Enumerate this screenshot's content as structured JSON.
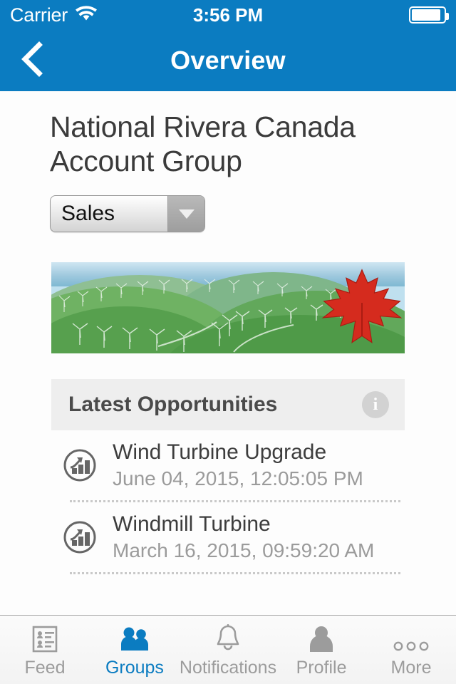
{
  "status_bar": {
    "carrier": "Carrier",
    "wifi_icon": "wifi-icon",
    "time": "3:56 PM",
    "battery_icon": "battery-icon"
  },
  "nav_bar": {
    "back_icon": "chevron-left-icon",
    "title": "Overview",
    "background_color": "#0b7cc1"
  },
  "main": {
    "page_title": "National Rivera Canada Account Group",
    "record_type_select": {
      "value": "Sales",
      "arrow_icon": "chevron-down-icon"
    },
    "banner": {
      "alt": "wind-farm-landscape-with-maple-leaf",
      "overlay_icon": "maple-leaf-icon"
    },
    "section": {
      "title": "Latest Opportunities",
      "info_icon": "info-icon",
      "info_glyph": "i",
      "background_color": "#eeeeee"
    },
    "opportunities": [
      {
        "icon": "opportunity-chart-icon",
        "title": "Wind Turbine Upgrade",
        "timestamp": "June 04, 2015, 12:05:05 PM"
      },
      {
        "icon": "opportunity-chart-icon",
        "title": "Windmill Turbine",
        "timestamp": "March 16, 2015, 09:59:20 AM"
      }
    ]
  },
  "tab_bar": {
    "active_color": "#0b7cc1",
    "inactive_color": "#9c9c9c",
    "tabs": [
      {
        "label": "Feed",
        "icon": "feed-list-icon",
        "active": false
      },
      {
        "label": "Groups",
        "icon": "groups-people-icon",
        "active": true
      },
      {
        "label": "Notifications",
        "icon": "bell-icon",
        "active": false
      },
      {
        "label": "Profile",
        "icon": "person-icon",
        "active": false
      },
      {
        "label": "More",
        "icon": "ellipsis-icon",
        "active": false
      }
    ]
  }
}
